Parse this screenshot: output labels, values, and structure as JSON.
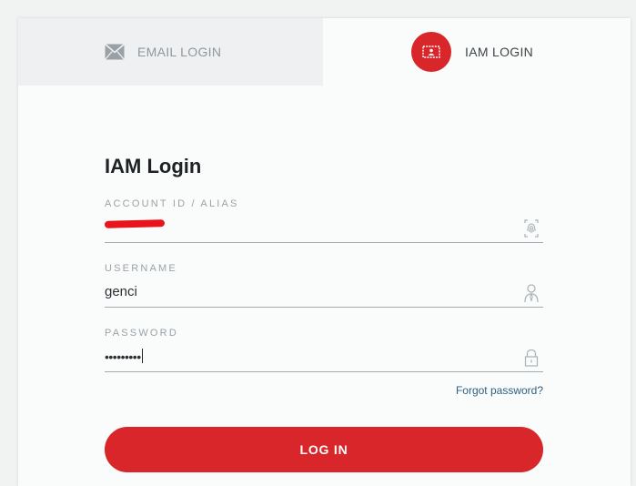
{
  "tabs": {
    "email": {
      "label": "EMAIL LOGIN",
      "icon": "mail-icon"
    },
    "iam": {
      "label": "IAM LOGIN",
      "icon": "iam-badge-icon",
      "active": true
    }
  },
  "form": {
    "title": "IAM Login",
    "account": {
      "label": "ACCOUNT ID / ALIAS",
      "value_redacted": true,
      "icon": "fingerprint-icon"
    },
    "username": {
      "label": "USERNAME",
      "value": "genci",
      "icon": "user-icon"
    },
    "password": {
      "label": "PASSWORD",
      "masked_value": "•••••••••",
      "icon": "lock-icon"
    },
    "forgot_label": "Forgot password?",
    "submit_label": "LOG IN"
  },
  "colors": {
    "accent": "#d8262a",
    "link": "#2f5f82",
    "redaction": "#e8141c"
  }
}
